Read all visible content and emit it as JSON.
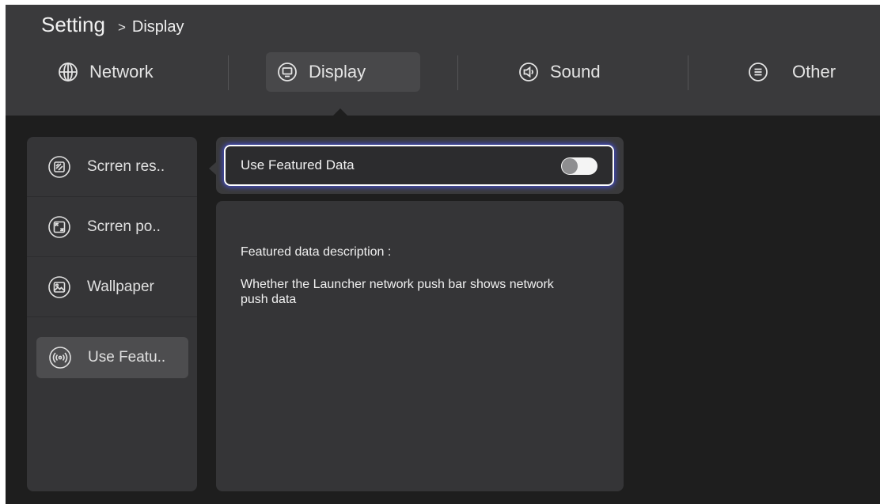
{
  "breadcrumb": {
    "root": "Setting",
    "separator": ">",
    "current": "Display"
  },
  "tabs": [
    {
      "label": "Network",
      "icon": "globe-icon",
      "active": false
    },
    {
      "label": "Display",
      "icon": "monitor-icon",
      "active": true
    },
    {
      "label": "Sound",
      "icon": "speaker-icon",
      "active": false
    },
    {
      "label": "Other",
      "icon": "menu-circle-icon",
      "active": false
    }
  ],
  "sidebar": {
    "items": [
      {
        "label": "Scrren res..",
        "icon": "screen-resolution-icon",
        "selected": false
      },
      {
        "label": "Scrren po..",
        "icon": "screen-position-icon",
        "selected": false
      },
      {
        "label": "Wallpaper",
        "icon": "wallpaper-icon",
        "selected": false
      },
      {
        "label": "Use Featu..",
        "icon": "broadcast-icon",
        "selected": true
      }
    ]
  },
  "option": {
    "label": "Use Featured Data",
    "enabled": false
  },
  "description": {
    "title": "Featured data description :",
    "text": "Whether the Launcher network push bar shows network push data"
  },
  "colors": {
    "background": "#1e1e1e",
    "header": "#3a3a3c",
    "panel": "#353537",
    "selected": "#4d4d4f",
    "focus_glow": "#4650e6",
    "text": "#e8e8e8"
  }
}
